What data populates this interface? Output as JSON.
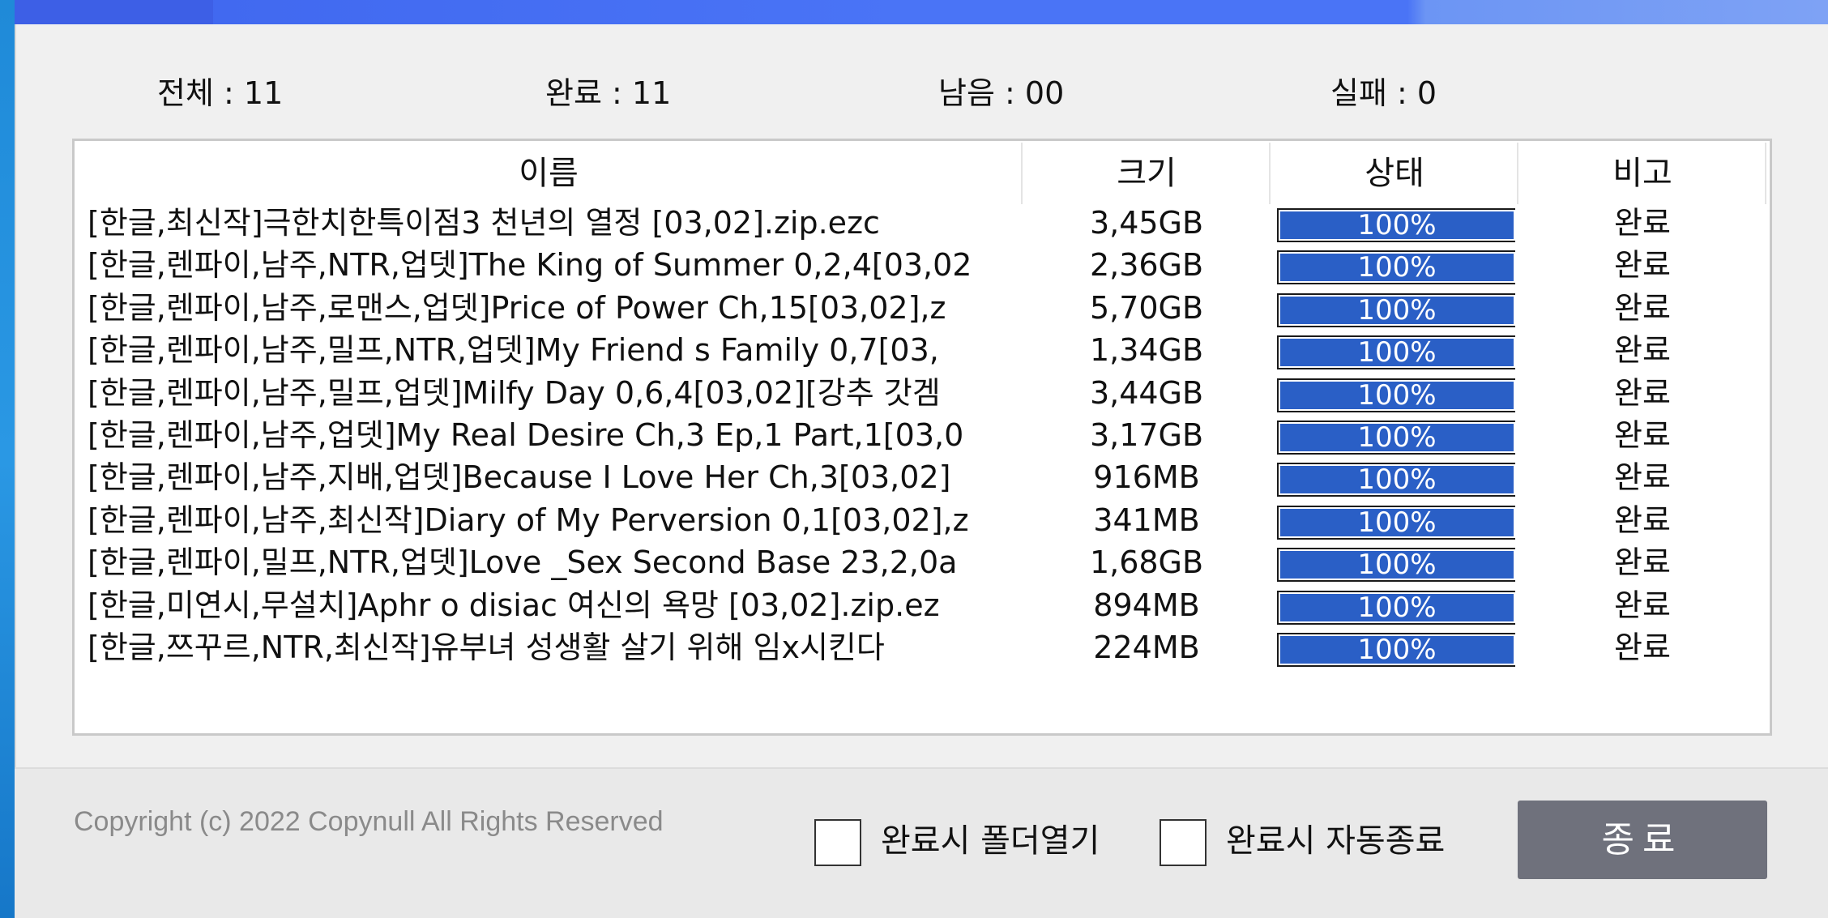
{
  "stats": {
    "total": {
      "label": "전체 : ",
      "value": "11"
    },
    "done": {
      "label": "완료 : ",
      "value": "11"
    },
    "remaining": {
      "label": "남음 : ",
      "value": "00"
    },
    "failed": {
      "label": "실패 : ",
      "value": "0"
    }
  },
  "columns": {
    "name": "이름",
    "size": "크기",
    "status": "상태",
    "note": "비고"
  },
  "rows": [
    {
      "name": "[한글,최신작]극한치한특이점3 천년의 열정 [03,02].zip.ezc",
      "size": "3,45GB",
      "progress": 100,
      "progress_label": "100%",
      "note": "완료"
    },
    {
      "name": "[한글,렌파이,남주,NTR,업뎃]The King of Summer 0,2,4[03,02",
      "size": "2,36GB",
      "progress": 100,
      "progress_label": "100%",
      "note": "완료"
    },
    {
      "name": "[한글,렌파이,남주,로맨스,업뎃]Price of Power Ch,15[03,02],z",
      "size": "5,70GB",
      "progress": 100,
      "progress_label": "100%",
      "note": "완료"
    },
    {
      "name": "[한글,렌파이,남주,밀프,NTR,업뎃]My Friend s Family 0,7[03,",
      "size": "1,34GB",
      "progress": 100,
      "progress_label": "100%",
      "note": "완료"
    },
    {
      "name": "[한글,렌파이,남주,밀프,업뎃]Milfy Day 0,6,4[03,02][강추 갓겜",
      "size": "3,44GB",
      "progress": 100,
      "progress_label": "100%",
      "note": "완료"
    },
    {
      "name": "[한글,렌파이,남주,업뎃]My Real Desire Ch,3 Ep,1 Part,1[03,0",
      "size": "3,17GB",
      "progress": 100,
      "progress_label": "100%",
      "note": "완료"
    },
    {
      "name": "[한글,렌파이,남주,지배,업뎃]Because I Love Her Ch,3[03,02]",
      "size": "916MB",
      "progress": 100,
      "progress_label": "100%",
      "note": "완료"
    },
    {
      "name": "[한글,렌파이,남주,최신작]Diary of My Perversion 0,1[03,02],z",
      "size": "341MB",
      "progress": 100,
      "progress_label": "100%",
      "note": "완료"
    },
    {
      "name": "[한글,렌파이,밀프,NTR,업뎃]Love _Sex Second Base 23,2,0a",
      "size": "1,68GB",
      "progress": 100,
      "progress_label": "100%",
      "note": "완료"
    },
    {
      "name": "[한글,미연시,무설치]Aphr o disiac 여신의 욕망 [03,02].zip.ez",
      "size": "894MB",
      "progress": 100,
      "progress_label": "100%",
      "note": "완료"
    },
    {
      "name": "[한글,쯔꾸르,NTR,최신작]유부녀 성생활 살기 위해 임x시킨다",
      "size": "224MB",
      "progress": 100,
      "progress_label": "100%",
      "note": "완료"
    }
  ],
  "footer": {
    "copyright": "Copyright (c) 2022 Copynull All Rights Reserved",
    "open_folder_label": "완료시 폴더열기",
    "open_folder_checked": false,
    "auto_exit_label": "완료시 자동종료",
    "auto_exit_checked": false,
    "exit_button_label": "종료"
  },
  "colors": {
    "progress_fill": "#2a5fc6",
    "exit_button": "#6f717c",
    "title_bar": "#4a74f6"
  }
}
